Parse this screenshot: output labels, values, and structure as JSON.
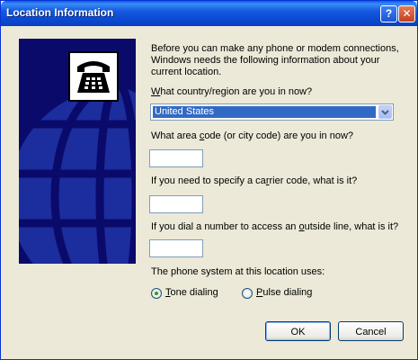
{
  "window": {
    "title": "Location Information"
  },
  "titlebar_buttons": {
    "help": "?",
    "close": "✕"
  },
  "intro": "Before you can make any phone or modem connections, Windows needs the following information about your current location.",
  "country": {
    "label_pre": "",
    "label_u": "W",
    "label_post": "hat country/region are you in now?",
    "selected": "United States"
  },
  "area_code": {
    "label_pre": "What area ",
    "label_u": "c",
    "label_post": "ode (or city code) are you in now?",
    "value": ""
  },
  "carrier_code": {
    "label_pre": "If you need to specify a ca",
    "label_u": "r",
    "label_post": "rier code, what is it?",
    "value": ""
  },
  "outside_line": {
    "label_pre": "If you dial a number to access an ",
    "label_u": "o",
    "label_post": "utside line, what is it?",
    "value": ""
  },
  "phone_system": {
    "label": "The phone system at this location uses:",
    "tone": {
      "u": "T",
      "rest": "one dialing",
      "checked": true
    },
    "pulse": {
      "u": "P",
      "rest": "ulse dialing",
      "checked": false
    }
  },
  "buttons": {
    "ok": "OK",
    "cancel": "Cancel"
  },
  "colors": {
    "side_panel": "#0a0a6a",
    "selection": "#316ac5",
    "titlebar": "#0a49d1"
  }
}
